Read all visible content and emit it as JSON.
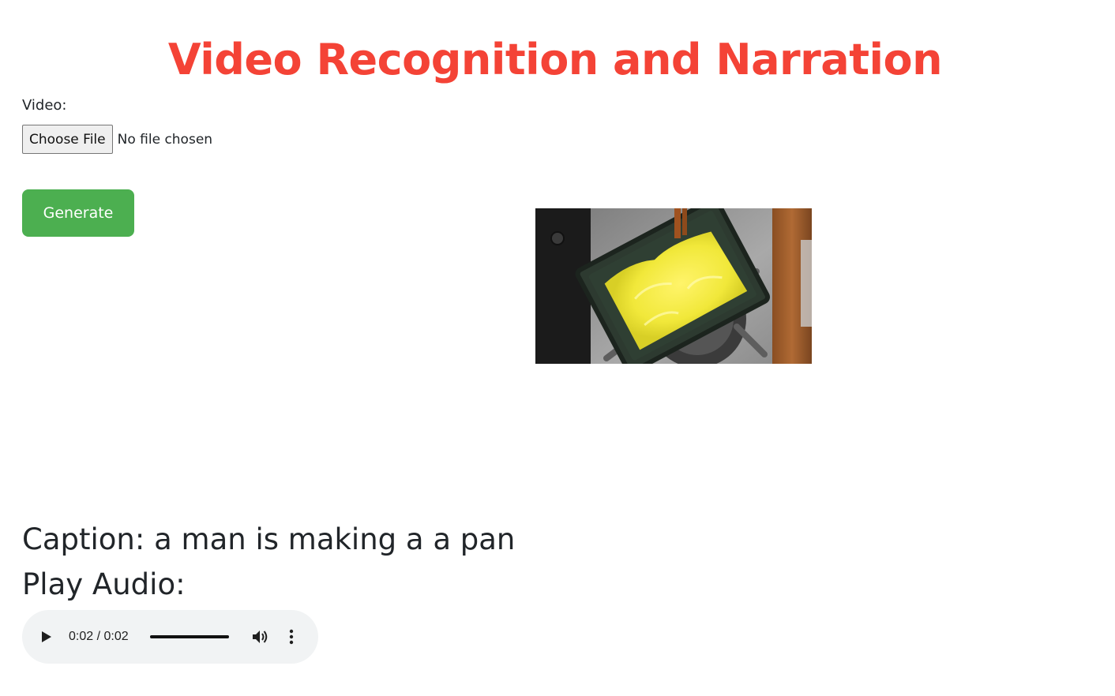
{
  "page": {
    "title": "Video Recognition and Narration"
  },
  "form": {
    "video_label": "Video:",
    "file_button_label": "Choose File",
    "file_status": "No file chosen",
    "generate_label": "Generate"
  },
  "result": {
    "caption_text": "Caption: a man is making a a pan",
    "audio_heading": "Play Audio:"
  },
  "audio_player": {
    "time_display": "0:02 / 0:02",
    "progress_fraction": 1.0,
    "play_icon": "play-icon",
    "volume_icon": "volume-icon",
    "menu_icon": "more-vertical-icon"
  },
  "colors": {
    "title": "#f44336",
    "generate_button": "#4caf50",
    "audio_player_bg": "#f1f3f4"
  }
}
